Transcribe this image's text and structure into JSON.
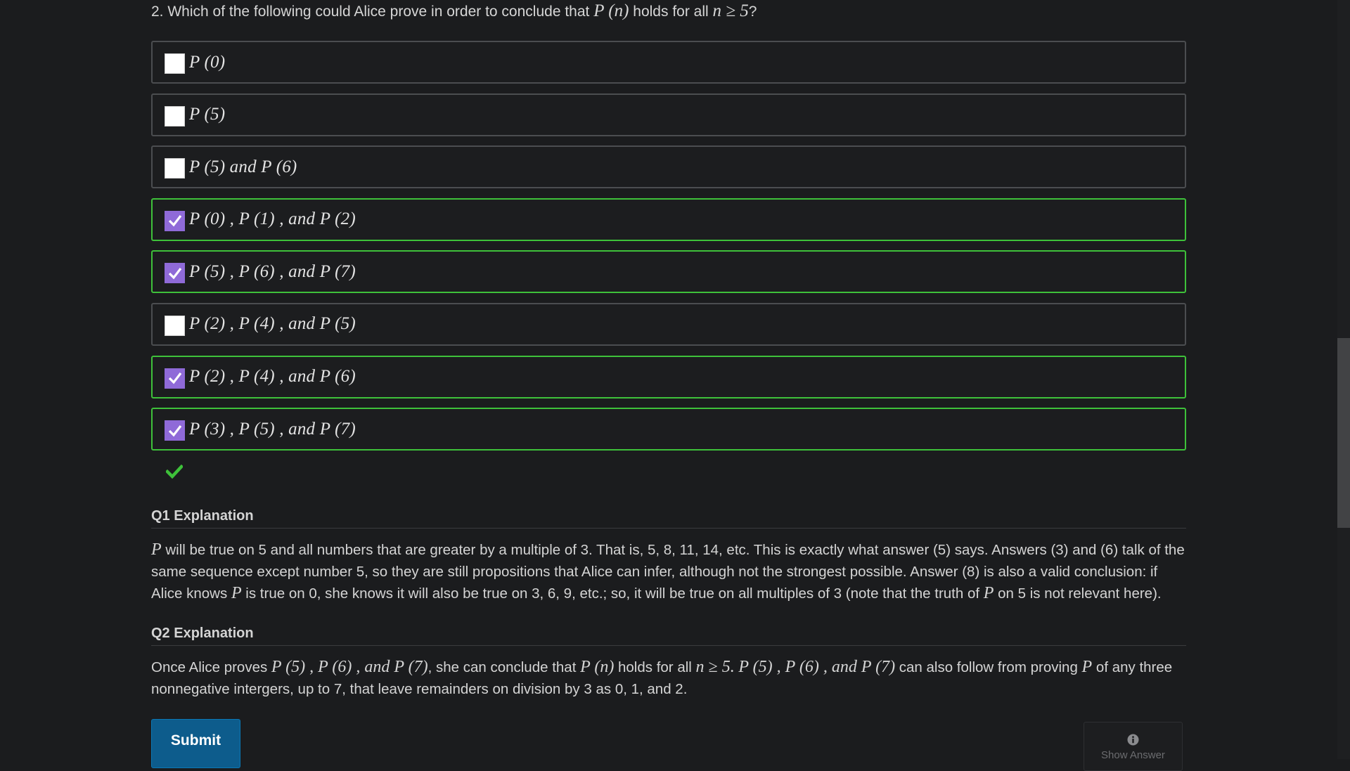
{
  "question": {
    "prefix": "2. Which of the following could Alice prove in order to conclude that",
    "m1": "P (n)",
    "mid": "holds for all",
    "m2": "n ≥ 5",
    "suffix": "?"
  },
  "options": [
    {
      "text": "P (0)",
      "checked": false,
      "correct": false
    },
    {
      "text": "P (5)",
      "checked": false,
      "correct": false
    },
    {
      "text": "P (5)  and P (6)",
      "checked": false,
      "correct": false
    },
    {
      "text": "P (0) , P (1) ,  and P (2)",
      "checked": true,
      "correct": true
    },
    {
      "text": "P (5) , P (6) ,  and P (7)",
      "checked": true,
      "correct": true
    },
    {
      "text": "P (2) , P (4) ,  and P (5)",
      "checked": false,
      "correct": false
    },
    {
      "text": "P (2) , P (4) ,  and P (6)",
      "checked": true,
      "correct": true
    },
    {
      "text": "P (3) , P (5) ,  and P (7)",
      "checked": true,
      "correct": true
    }
  ],
  "colors": {
    "correct_border": "#3ec13a",
    "checkbox_checked": "#8f6ad8",
    "submit_bg": "#0d5c8c",
    "result_check": "#3ec13a"
  },
  "q1": {
    "title": "Q1 Explanation",
    "s1": "P",
    "t1": " will be true on 5 and all numbers that are greater by a multiple of 3. That is, 5, 8, 11, 14, etc. This is exactly what answer (5) says. Answers (3) and (6) talk of the same sequence except number 5, so they are still propositions that Alice can infer, although not the strongest possible. Answer (8) is also a valid conclusion: if Alice knows ",
    "s2": "P",
    "t2": " is true on 0, she knows it will also be true on 3, 6, 9, etc.; so, it will be true on all multiples of 3 (note that the truth of ",
    "s3": "P",
    "t3": " on 5 is not relevant here)."
  },
  "q2": {
    "title": "Q2 Explanation",
    "t1": "Once Alice proves ",
    "m1": "P (5) , P (6) ,  and P (7)",
    "t2": ", she can conclude that ",
    "m2": "P (n)",
    "t3": " holds for all ",
    "m3": "n ≥ 5.",
    "t4": " ",
    "m4": "P (5) , P (6) ,  and P (7)",
    "t5": " can also follow from proving ",
    "m5": "P",
    "t6": " of any three nonnegative intergers, up to 7, that leave remainders on division by 3 as 0, 1, and 2."
  },
  "buttons": {
    "submit": "Submit",
    "show_answer": "Show Answer"
  },
  "icons": {
    "result": "checkmark-icon",
    "show_answer": "info-icon"
  }
}
